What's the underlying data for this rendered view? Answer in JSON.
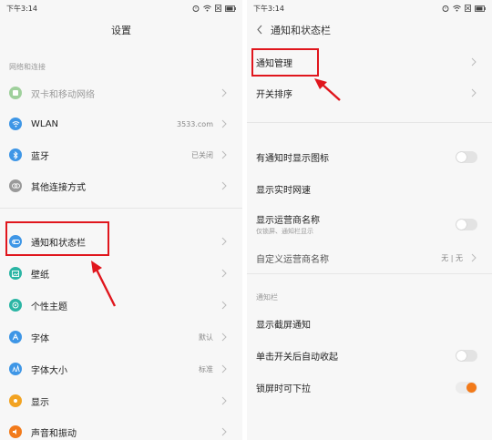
{
  "left": {
    "status_time": "下午3:14",
    "title": "设置",
    "section_network": "网络和连接",
    "items": [
      {
        "label": "双卡和移动网络",
        "value": ""
      },
      {
        "label": "WLAN",
        "value": "3533.com"
      },
      {
        "label": "蓝牙",
        "value": "已关闭"
      },
      {
        "label": "其他连接方式",
        "value": ""
      },
      {
        "label": "通知和状态栏",
        "value": ""
      },
      {
        "label": "壁纸",
        "value": ""
      },
      {
        "label": "个性主题",
        "value": ""
      },
      {
        "label": "字体",
        "value": "默认"
      },
      {
        "label": "字体大小",
        "value": "标准"
      },
      {
        "label": "显示",
        "value": ""
      },
      {
        "label": "声音和振动",
        "value": ""
      }
    ],
    "icon_names": [
      "sim-card-icon",
      "wifi-icon",
      "bluetooth-icon",
      "link-icon",
      "notification-icon",
      "wallpaper-icon",
      "theme-icon",
      "font-icon",
      "font-size-icon",
      "display-icon",
      "sound-icon"
    ],
    "icon_colors": [
      "#7dc17a",
      "#3e96e6",
      "#3e96e6",
      "#9a9a9a",
      "#3e96e6",
      "#2bb5a4",
      "#2bb5a4",
      "#3e96e6",
      "#3e96e6",
      "#f2a322",
      "#f27a1a"
    ]
  },
  "right": {
    "status_time": "下午3:14",
    "title": "通知和状态栏",
    "items": [
      {
        "label": "通知管理"
      },
      {
        "label": "开关排序"
      },
      {
        "label": "有通知时显示图标"
      },
      {
        "label": "显示实时网速"
      },
      {
        "label": "显示运营商名称",
        "sub": "仅锁屏、通知栏显示"
      },
      {
        "label": "自定义运营商名称",
        "value": "无 | 无"
      }
    ],
    "section_notify": "通知栏",
    "items2": [
      {
        "label": "显示截屏通知"
      },
      {
        "label": "单击开关后自动收起"
      },
      {
        "label": "锁屏时可下拉"
      }
    ]
  },
  "accent_color": "#e0161d",
  "toggle_on_color": "#f27a1a"
}
